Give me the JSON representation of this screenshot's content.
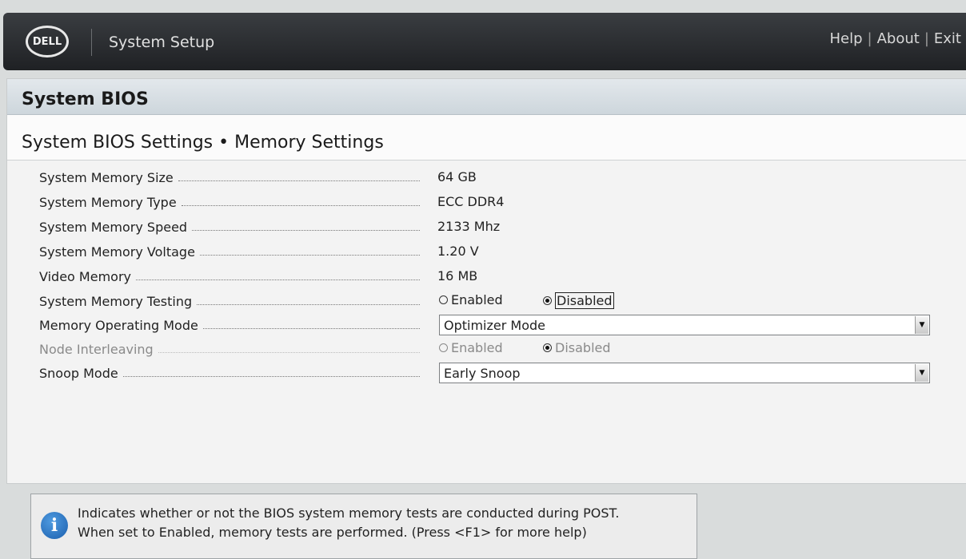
{
  "header": {
    "logo_text": "DELL",
    "app_title": "System Setup",
    "links": [
      "Help",
      "About",
      "Exit"
    ]
  },
  "panel": {
    "title": "System BIOS",
    "breadcrumb": "System BIOS Settings • Memory Settings"
  },
  "settings": {
    "memory_size": {
      "label": "System Memory Size",
      "value": "64 GB"
    },
    "memory_type": {
      "label": "System Memory Type",
      "value": "ECC DDR4"
    },
    "memory_speed": {
      "label": "System Memory Speed",
      "value": "2133 Mhz"
    },
    "memory_voltage": {
      "label": "System Memory Voltage",
      "value": "1.20 V"
    },
    "video_memory": {
      "label": "Video Memory",
      "value": "16 MB"
    },
    "memory_testing": {
      "label": "System Memory Testing",
      "option_enabled": "Enabled",
      "option_disabled": "Disabled",
      "selected": "Disabled"
    },
    "operating_mode": {
      "label": "Memory Operating Mode",
      "value": "Optimizer Mode"
    },
    "node_interleaving": {
      "label": "Node Interleaving",
      "option_enabled": "Enabled",
      "option_disabled": "Disabled",
      "selected": "Disabled"
    },
    "snoop_mode": {
      "label": "Snoop Mode",
      "value": "Early Snoop"
    }
  },
  "help": {
    "line1": "Indicates whether or not the BIOS system memory tests are conducted during POST.",
    "line2": "When set to Enabled, memory tests are performed. (Press <F1> for more help)"
  },
  "icons": {
    "info": "info-icon",
    "dropdown": "chevron-down-icon"
  },
  "colors": {
    "topbar": "#2a2c2f",
    "panel_header": "#d6dde2",
    "info_icon": "#2a74c4"
  }
}
